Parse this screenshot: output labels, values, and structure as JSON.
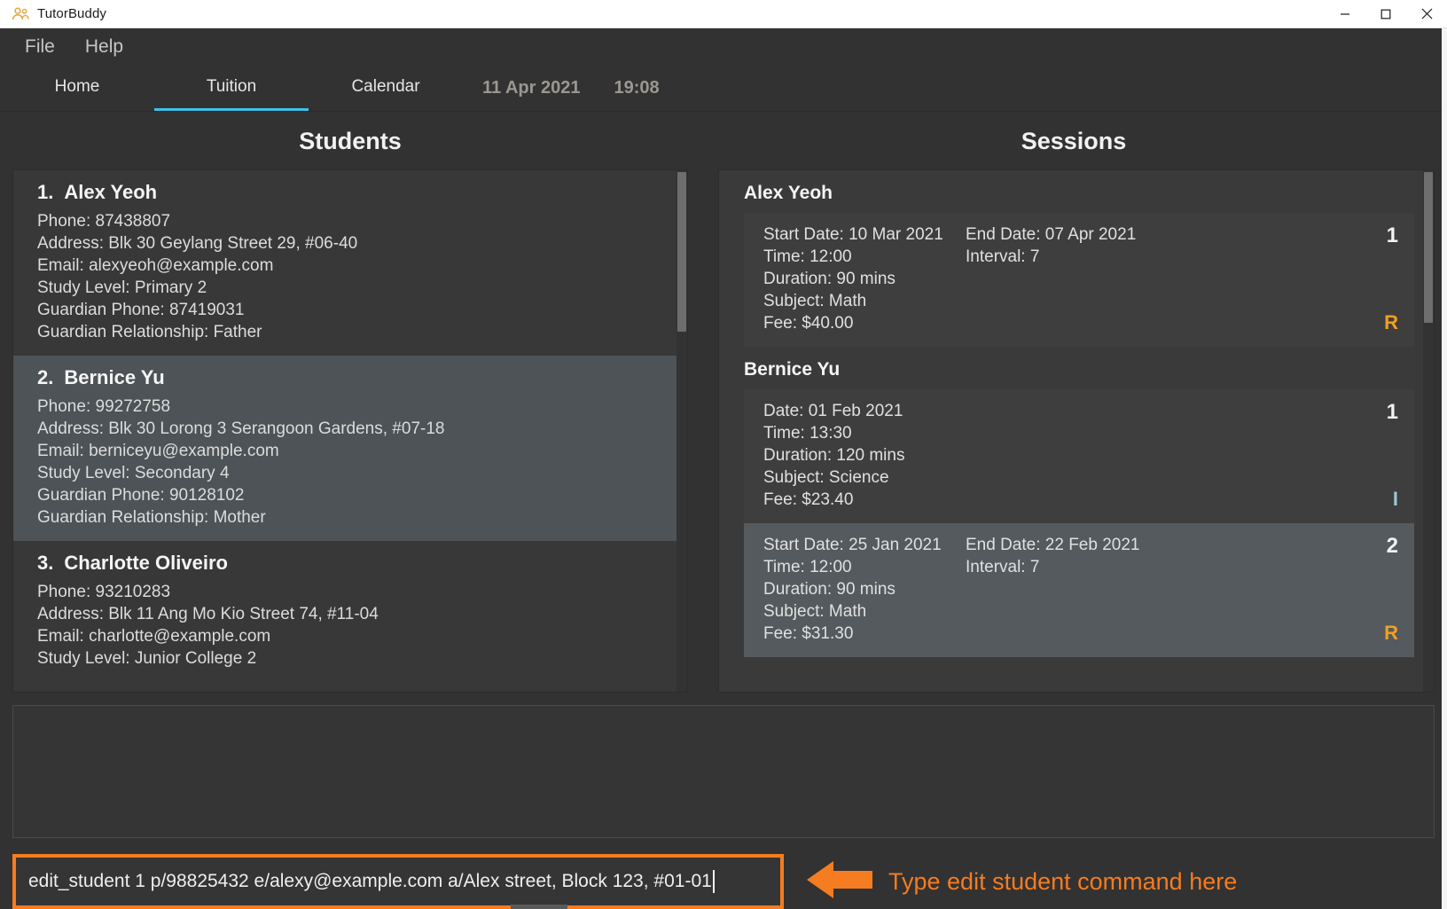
{
  "window": {
    "title": "TutorBuddy",
    "icon": "people-icon",
    "controls": {
      "minimize": "minimize-icon",
      "maximize": "maximize-icon",
      "close": "close-icon"
    }
  },
  "menubar": {
    "items": [
      "File",
      "Help"
    ]
  },
  "tabs": [
    {
      "label": "Home",
      "active": false
    },
    {
      "label": "Tuition",
      "active": true
    },
    {
      "label": "Calendar",
      "active": false
    }
  ],
  "status": {
    "date": "11 Apr 2021",
    "time": "19:08"
  },
  "students_panel": {
    "title": "Students",
    "items": [
      {
        "index": "1.",
        "name": "Alex Yeoh",
        "selected": false,
        "lines": [
          "Phone: 87438807",
          "Address: Blk 30 Geylang Street 29, #06-40",
          "Email: alexyeoh@example.com",
          "Study Level: Primary 2",
          "Guardian Phone: 87419031",
          "Guardian Relationship: Father"
        ]
      },
      {
        "index": "2.",
        "name": "Bernice Yu",
        "selected": true,
        "lines": [
          "Phone: 99272758",
          "Address: Blk 30 Lorong 3 Serangoon Gardens, #07-18",
          "Email: berniceyu@example.com",
          "Study Level: Secondary 4",
          "Guardian Phone: 90128102",
          "Guardian Relationship: Mother"
        ]
      },
      {
        "index": "3.",
        "name": "Charlotte Oliveiro",
        "selected": false,
        "lines": [
          "Phone: 93210283",
          "Address: Blk 11 Ang Mo Kio Street 74, #11-04",
          "Email: charlotte@example.com",
          "Study Level: Junior College 2"
        ]
      }
    ]
  },
  "sessions_panel": {
    "title": "Sessions",
    "groups": [
      {
        "student": "Alex Yeoh",
        "sessions": [
          {
            "selected": false,
            "left": [
              "Start Date: 10 Mar 2021",
              "Time: 12:00",
              "Duration: 90 mins",
              "Subject: Math",
              "Fee: $40.00"
            ],
            "right": [
              "End Date: 07 Apr 2021",
              "Interval: 7"
            ],
            "number": "1",
            "tag": "R",
            "tag_color": "#f0a020"
          }
        ]
      },
      {
        "student": "Bernice Yu",
        "sessions": [
          {
            "selected": false,
            "left": [
              "Date: 01 Feb 2021",
              "Time: 13:30",
              "Duration: 120 mins",
              "Subject: Science",
              "Fee: $23.40"
            ],
            "right": [],
            "number": "1",
            "tag": "I",
            "tag_color": "#9fc5d6"
          },
          {
            "selected": true,
            "left": [
              "Start Date: 25 Jan 2021",
              "Time: 12:00",
              "Duration: 90 mins",
              "Subject: Math",
              "Fee: $31.30"
            ],
            "right": [
              "End Date: 22 Feb 2021",
              "Interval: 7"
            ],
            "number": "2",
            "tag": "R",
            "tag_color": "#f0a020"
          }
        ]
      }
    ]
  },
  "result_box": {
    "text": ""
  },
  "command_box": {
    "value": "edit_student 1 p/98825432 e/alexy@example.com a/Alex street, Block 123, #01-01",
    "border_color": "#f57c20"
  },
  "annotation": {
    "text": "Type edit student command here",
    "color": "#f57c20",
    "arrow": "arrow-left-icon"
  }
}
